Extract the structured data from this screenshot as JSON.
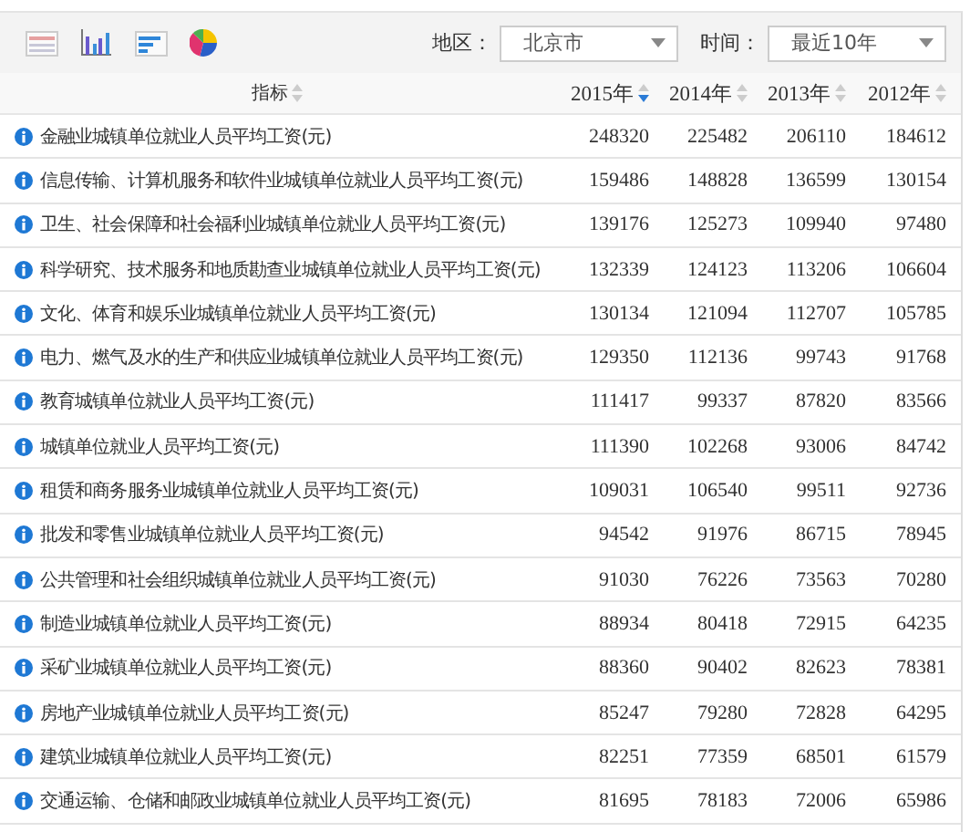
{
  "toolbar": {
    "filters": [
      {
        "label": "地区：",
        "value": "北京市"
      },
      {
        "label": "时间：",
        "value": "最近10年"
      }
    ]
  },
  "table": {
    "columns": [
      {
        "label": "指标",
        "sorted": false
      },
      {
        "label": "2015年",
        "sorted": true
      },
      {
        "label": "2014年",
        "sorted": false
      },
      {
        "label": "2013年",
        "sorted": false
      },
      {
        "label": "2012年",
        "sorted": false
      }
    ],
    "rows": [
      {
        "name": "金融业城镇单位就业人员平均工资(元)",
        "values": [
          "248320",
          "225482",
          "206110",
          "184612"
        ]
      },
      {
        "name": "信息传输、计算机服务和软件业城镇单位就业人员平均工资(元)",
        "values": [
          "159486",
          "148828",
          "136599",
          "130154"
        ]
      },
      {
        "name": "卫生、社会保障和社会福利业城镇单位就业人员平均工资(元)",
        "values": [
          "139176",
          "125273",
          "109940",
          "97480"
        ]
      },
      {
        "name": "科学研究、技术服务和地质勘查业城镇单位就业人员平均工资(元)",
        "values": [
          "132339",
          "124123",
          "113206",
          "106604"
        ]
      },
      {
        "name": "文化、体育和娱乐业城镇单位就业人员平均工资(元)",
        "values": [
          "130134",
          "121094",
          "112707",
          "105785"
        ]
      },
      {
        "name": "电力、燃气及水的生产和供应业城镇单位就业人员平均工资(元)",
        "values": [
          "129350",
          "112136",
          "99743",
          "91768"
        ]
      },
      {
        "name": "教育城镇单位就业人员平均工资(元)",
        "values": [
          "111417",
          "99337",
          "87820",
          "83566"
        ]
      },
      {
        "name": "城镇单位就业人员平均工资(元)",
        "values": [
          "111390",
          "102268",
          "93006",
          "84742"
        ]
      },
      {
        "name": "租赁和商务服务业城镇单位就业人员平均工资(元)",
        "values": [
          "109031",
          "106540",
          "99511",
          "92736"
        ]
      },
      {
        "name": "批发和零售业城镇单位就业人员平均工资(元)",
        "values": [
          "94542",
          "91976",
          "86715",
          "78945"
        ]
      },
      {
        "name": "公共管理和社会组织城镇单位就业人员平均工资(元)",
        "values": [
          "91030",
          "76226",
          "73563",
          "70280"
        ]
      },
      {
        "name": "制造业城镇单位就业人员平均工资(元)",
        "values": [
          "88934",
          "80418",
          "72915",
          "64235"
        ]
      },
      {
        "name": "采矿业城镇单位就业人员平均工资(元)",
        "values": [
          "88360",
          "90402",
          "82623",
          "78381"
        ]
      },
      {
        "name": "房地产业城镇单位就业人员平均工资(元)",
        "values": [
          "85247",
          "79280",
          "72828",
          "64295"
        ]
      },
      {
        "name": "建筑业城镇单位就业人员平均工资(元)",
        "values": [
          "82251",
          "77359",
          "68501",
          "61579"
        ]
      },
      {
        "name": "交通运输、仓储和邮政业城镇单位就业人员平均工资(元)",
        "values": [
          "81695",
          "78183",
          "72006",
          "65986"
        ]
      }
    ]
  }
}
